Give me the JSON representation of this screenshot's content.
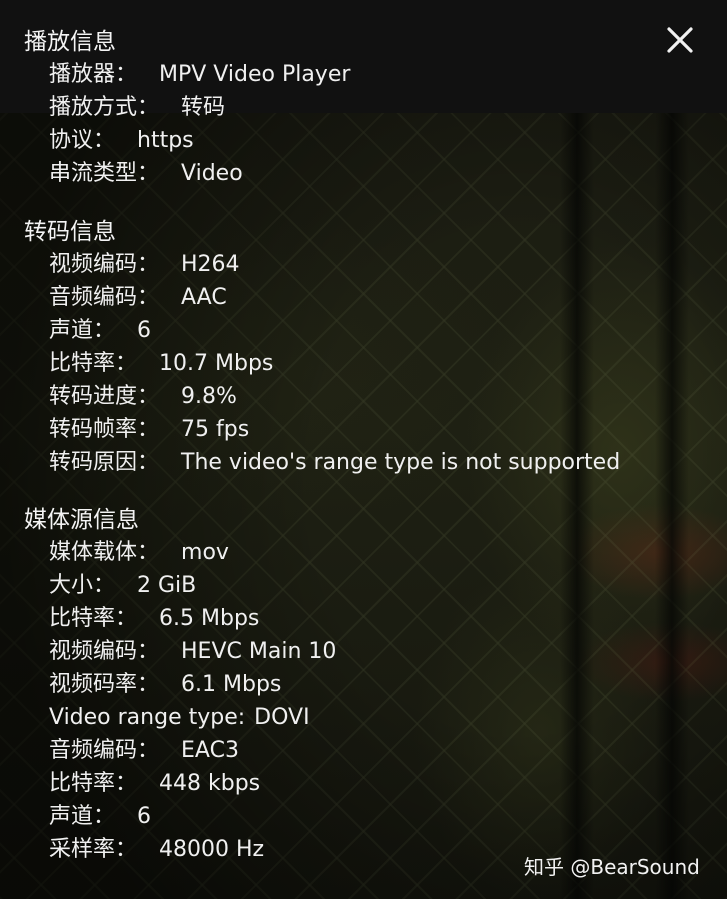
{
  "sections": [
    {
      "title": "播放信息",
      "rows": [
        {
          "label": "播放器：",
          "value": "MPV Video Player"
        },
        {
          "label": "播放方式：",
          "value": "转码"
        },
        {
          "label": "协议：",
          "value": "https"
        },
        {
          "label": "串流类型：",
          "value": "Video"
        }
      ]
    },
    {
      "title": "转码信息",
      "rows": [
        {
          "label": "视频编码：",
          "value": "H264"
        },
        {
          "label": "音频编码：",
          "value": "AAC"
        },
        {
          "label": "声道：",
          "value": "6"
        },
        {
          "label": "比特率：",
          "value": "10.7 Mbps"
        },
        {
          "label": "转码进度：",
          "value": "9.8%"
        },
        {
          "label": "转码帧率：",
          "value": "75 fps"
        },
        {
          "label": "转码原因：",
          "value": "The video's range type is not supported"
        }
      ]
    },
    {
      "title": "媒体源信息",
      "rows": [
        {
          "label": "媒体载体：",
          "value": "mov"
        },
        {
          "label": "大小：",
          "value": "2 GiB"
        },
        {
          "label": "比特率：",
          "value": "6.5 Mbps"
        },
        {
          "label": "视频编码：",
          "value": "HEVC Main 10"
        },
        {
          "label": "视频码率：",
          "value": "6.1 Mbps"
        },
        {
          "label": "Video range type:",
          "value": "DOVI"
        },
        {
          "label": "音频编码：",
          "value": "EAC3"
        },
        {
          "label": "比特率：",
          "value": "448 kbps"
        },
        {
          "label": "声道：",
          "value": "6"
        },
        {
          "label": "采样率：",
          "value": "48000 Hz"
        }
      ]
    }
  ],
  "close_icon": "close-icon",
  "watermark": "知乎 @BearSound",
  "colors": {
    "text": "#f0f0f0",
    "top_bar": "#111111"
  }
}
